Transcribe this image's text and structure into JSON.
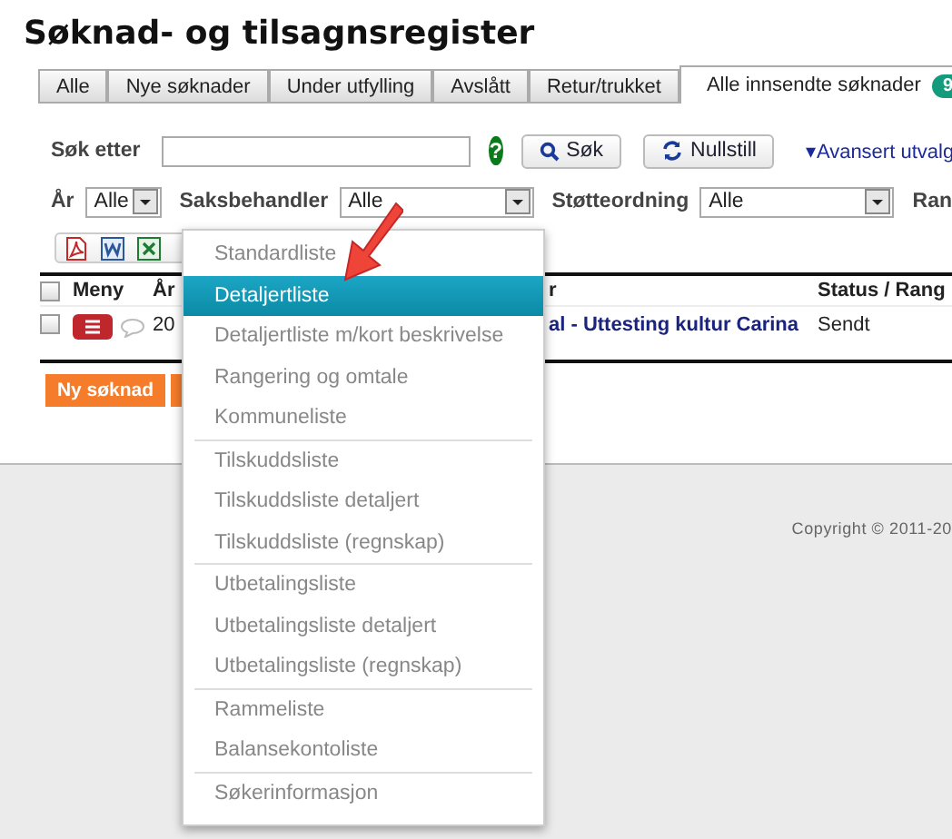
{
  "title": "Søknad- og tilsagnsregister",
  "tabs": [
    {
      "label": "Alle",
      "selected": false
    },
    {
      "label": "Nye søknader",
      "selected": false
    },
    {
      "label": "Under utfylling",
      "selected": false
    },
    {
      "label": "Avslått",
      "selected": false
    },
    {
      "label": "Retur/trukket",
      "selected": false
    },
    {
      "label": "Alle innsendte søknader",
      "selected": true,
      "badge": "9"
    }
  ],
  "search": {
    "label": "Søk etter",
    "help": "?",
    "search_button": "Søk",
    "reset_button": "Nullstill",
    "advanced_link": "▾Avansert utvalg"
  },
  "filters": [
    {
      "label": "År",
      "value": "Alle",
      "kind": "select"
    },
    {
      "label": "Saksbehandler",
      "value": "Alle",
      "kind": "select"
    },
    {
      "label": "Støtteordning",
      "value": "Alle",
      "kind": "select"
    },
    {
      "label": "Ran",
      "kind": "label"
    }
  ],
  "table": {
    "header": {
      "checked": false,
      "columns": [
        "Meny",
        "År",
        "r",
        "Status / Rang"
      ]
    },
    "rows": [
      {
        "checked": false,
        "year": "20",
        "title": "al - Uttesting kultur Carina",
        "status": "Sendt"
      }
    ]
  },
  "new_button": "Ny søknad",
  "menu": {
    "groups": [
      {
        "items": [
          {
            "label": "Standardliste",
            "selected": false
          },
          {
            "label": "Detaljertliste",
            "selected": true
          },
          {
            "label": "Detaljertliste m/kort beskrivelse",
            "selected": false
          },
          {
            "label": "Rangering og omtale",
            "selected": false
          },
          {
            "label": "Kommuneliste",
            "selected": false
          }
        ]
      },
      {
        "items": [
          {
            "label": "Tilskuddsliste",
            "selected": false
          },
          {
            "label": "Tilskuddsliste detaljert",
            "selected": false
          },
          {
            "label": "Tilskuddsliste (regnskap)",
            "selected": false
          }
        ]
      },
      {
        "items": [
          {
            "label": "Utbetalingsliste",
            "selected": false
          },
          {
            "label": "Utbetalingsliste detaljert",
            "selected": false
          },
          {
            "label": "Utbetalingsliste (regnskap)",
            "selected": false
          }
        ]
      },
      {
        "items": [
          {
            "label": "Rammeliste",
            "selected": false
          },
          {
            "label": "Balansekontoliste",
            "selected": false
          }
        ]
      },
      {
        "items": [
          {
            "label": "Søkerinformasjon",
            "selected": false
          }
        ]
      }
    ]
  },
  "copyright": "Copyright © 2011-20"
}
